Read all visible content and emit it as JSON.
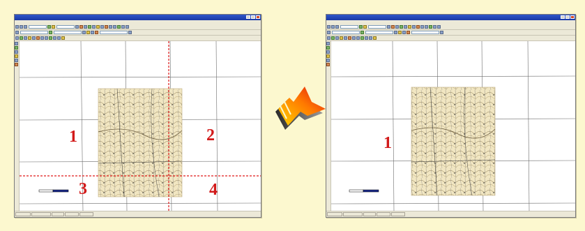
{
  "left_panel": {
    "quadrants": [
      {
        "name": "quadrant-1",
        "label": "1"
      },
      {
        "name": "quadrant-2",
        "label": "2"
      },
      {
        "name": "quadrant-3",
        "label": "3"
      },
      {
        "name": "quadrant-4",
        "label": "4"
      }
    ],
    "split_line_color": "#e01919"
  },
  "right_panel": {
    "quadrants": [
      {
        "name": "quadrant-1",
        "label": "1"
      }
    ]
  },
  "colors": {
    "background": "#fcf8cf",
    "quadrant_label": "#d21a1a",
    "grid": "#6b6b6b",
    "arrow_start": "#ffd400",
    "arrow_end": "#e01010"
  },
  "icons": [
    "transfer-arrow-icon",
    "scale-bar-icon",
    "topographic-map-tile-icon"
  ]
}
